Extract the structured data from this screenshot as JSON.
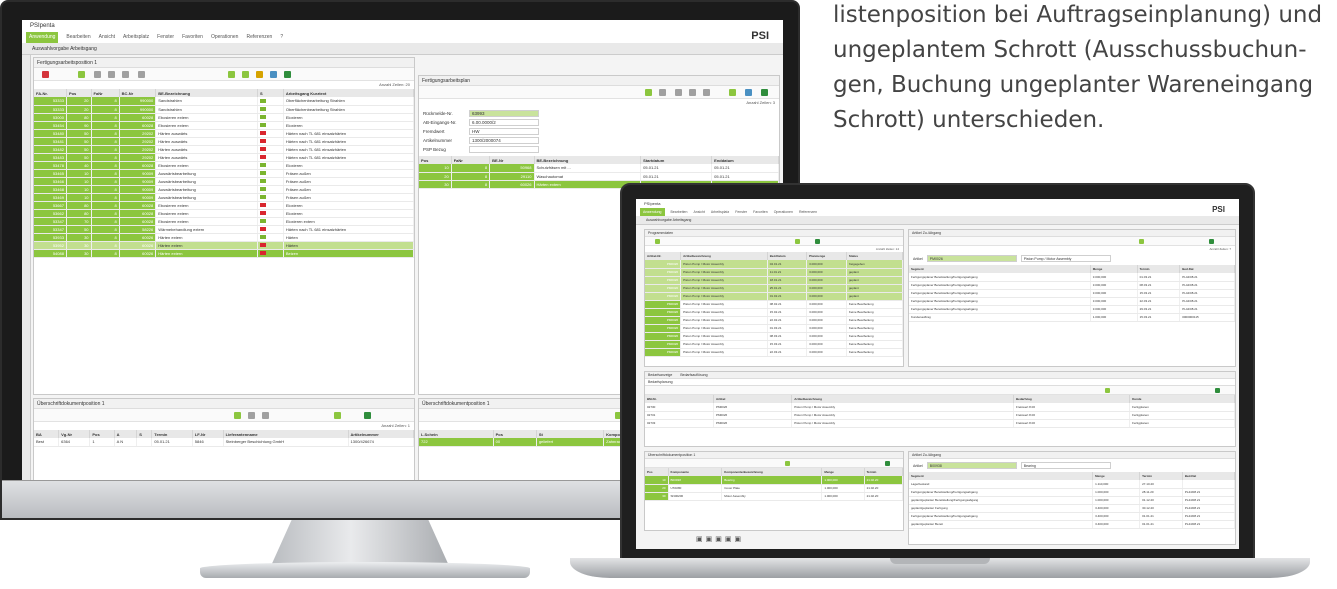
{
  "caption": {
    "lines": [
      "listenposition bei Auftragseinplanung) und",
      "ungeplantem Schrott (Ausschussbuchun-",
      "gen, Buchung ungeplanter Wareneingang",
      "Schrott) unterschieden."
    ]
  },
  "app": {
    "title": "PSIpenta",
    "logo": "PSI",
    "menu": [
      "Anwendung",
      "Bearbeiten",
      "Ansicht",
      "Arbeitsplatz",
      "Fenster",
      "Favoriten",
      "Operationen",
      "Referenzen",
      "?"
    ],
    "tab": "Auswahlvorgabe Arbeitsgang"
  },
  "monitor": {
    "left_panel": {
      "title": "Fertigungsarbeitsposition 1",
      "count": "Anzahl Zeilen: 20",
      "columns": [
        "FA-Nr.",
        "Pos",
        "FaNr",
        "BC-Nr",
        "BE-Bezeichnung",
        "S",
        "Arbeitsgang Kurztext"
      ],
      "rows": [
        [
          "53333",
          "20",
          "8",
          "990000",
          "Sandstrahlen",
          "grn",
          "Oberflächenbearbeitung Strahlen"
        ],
        [
          "53333",
          "20",
          "8",
          "990000",
          "Sandstrahlen",
          "grn",
          "Oberflächenbearbeitung Strahlen"
        ],
        [
          "53000",
          "80",
          "8",
          "60028",
          "Ebosieren extern",
          "grn",
          "Eloxieren"
        ],
        [
          "53454",
          "90",
          "8",
          "60028",
          "Ebosieren extern",
          "grn",
          "Eloxieren"
        ],
        [
          "53480",
          "50",
          "8",
          "29202",
          "Härten auswärts",
          "red",
          "Härten nach TL 681 einsatzhärten"
        ],
        [
          "53481",
          "50",
          "8",
          "29202",
          "Härten auswärts",
          "red",
          "Härten nach TL 681 einsatzhärten"
        ],
        [
          "53482",
          "50",
          "8",
          "29202",
          "Härten auswärts",
          "red",
          "Härten nach TL 681 einsatzhärten"
        ],
        [
          "53483",
          "50",
          "8",
          "29202",
          "Härten auswärts",
          "red",
          "Härten nach TL 681 einsatzhärten"
        ],
        [
          "53478",
          "40",
          "8",
          "60028",
          "Ebosieren extern",
          "grn",
          "Eloxieren"
        ],
        [
          "53465",
          "10",
          "8",
          "90009",
          "Auswärtsbearbeitung",
          "grn",
          "Fräsen außen"
        ],
        [
          "53466",
          "10",
          "8",
          "90009",
          "Auswärtsbearbeitung",
          "grn",
          "Fräsen außen"
        ],
        [
          "53468",
          "10",
          "8",
          "90009",
          "Auswärtsbearbeitung",
          "grn",
          "Fräsen außen"
        ],
        [
          "53469",
          "10",
          "8",
          "90009",
          "Auswärtsbearbeitung",
          "grn",
          "Fräsen außen"
        ],
        [
          "53667",
          "80",
          "8",
          "60028",
          "Ebosieren extern",
          "red",
          "Eloxieren"
        ],
        [
          "53662",
          "80",
          "8",
          "60028",
          "Ebosieren extern",
          "red",
          "Eloxieren"
        ],
        [
          "53347",
          "70",
          "8",
          "60028",
          "Ebosieren extern",
          "grn",
          "Eloxieren extern"
        ],
        [
          "53347",
          "50",
          "8",
          "58226",
          "Wärmebehandlung extern",
          "red",
          "Härten nach TL 681 einsatzhärten"
        ],
        [
          "53933",
          "30",
          "8",
          "60026",
          "Härten extern",
          "grn",
          "Härten"
        ],
        [
          "53952",
          "30",
          "8",
          "60026",
          "Härten extern",
          "red",
          "Härten"
        ],
        [
          "54088",
          "30",
          "8",
          "60026",
          "Härten extern",
          "red",
          "Beizen"
        ]
      ]
    },
    "right_panel": {
      "title": "Fertigungsarbeitsplan",
      "count": "Anzahl Zeilen: 3",
      "form": [
        [
          "Rückmelde-Nr.",
          "63993"
        ],
        [
          "AB-Eingangs-Nr.",
          "6.00.0000/2"
        ],
        [
          "Fremdwert",
          "HW"
        ],
        [
          "Artikelnummer",
          "1300/2000074"
        ],
        [
          "PSP Bezug",
          ""
        ]
      ],
      "columns": [
        "Pos",
        "FaNr",
        "BE-Nr",
        "BE-Bezeichnung",
        "Startdatum",
        "Enddatum"
      ],
      "rows": [
        [
          "10",
          "8",
          "50968",
          "Schutzfräsen mit ...",
          "05.01.21",
          "05.01.21"
        ],
        [
          "20",
          "8",
          "29110",
          "Waschautomat",
          "05.01.21",
          "05.01.21"
        ],
        [
          "30",
          "8",
          "60026",
          "Härten extern",
          "05.01.21",
          "05.01.21"
        ]
      ]
    },
    "bottom_left": {
      "title": "Überschriftdokumentposition 1",
      "count": "Anzahl Zeilen: 1",
      "columns": [
        "BA",
        "Vg-Nr",
        "Pos",
        "A",
        "S",
        "Termin",
        "LF-Nr",
        "Lieferantenname",
        "Artikelnummer"
      ],
      "row": [
        "Best",
        "6364",
        "1",
        "A N",
        "",
        "05.01.21",
        "5846",
        "Steinberger Beschichtung GmbH",
        "1300/426674"
      ]
    },
    "bottom_right": {
      "title": "Überschriftdokumentposition 1",
      "count": "Anzahl Zeilen: 1",
      "columns": [
        "L.Schein",
        "Pos",
        "St",
        "Komponente"
      ],
      "row": [
        "722",
        "00",
        "geliefert",
        "Zahnrad 65/0,9/22/4/17/2"
      ]
    }
  },
  "laptop": {
    "left_panel": {
      "title": "Programmdaten",
      "count": "Anzahl Zeilen: 14",
      "columns": [
        "Artikel-Nr.",
        "Artikelbezeichnung",
        "Bed.Datum",
        "Planmenge",
        "Status"
      ],
      "rows": [
        [
          "PM0026",
          "Piston Pump / Motor Assembly",
          "04.01.21",
          "3.000,000",
          "freigegeben"
        ],
        [
          "PM0026",
          "Piston Pump / Motor Assembly",
          "11.01.21",
          "3.000,000",
          "geplant"
        ],
        [
          "PM0026",
          "Piston Pump / Motor Assembly",
          "18.01.21",
          "3.000,000",
          "geplant"
        ],
        [
          "PM0026",
          "Piston Pump / Motor Assembly",
          "25.01.21",
          "3.000,000",
          "geplant"
        ],
        [
          "PM0026",
          "Piston Pump / Motor Assembly",
          "01.02.21",
          "3.000,000",
          "geplant"
        ],
        [
          "PM0026",
          "Piston Pump / Motor Assembly",
          "08.02.21",
          "3.000,000",
          "Keine Bearbeitung"
        ],
        [
          "PM0026",
          "Piston Pump / Motor Assembly",
          "15.02.21",
          "3.000,000",
          "Keine Bearbeitung"
        ],
        [
          "PM0026",
          "Piston Pump / Motor Assembly",
          "22.02.21",
          "3.000,000",
          "Keine Bearbeitung"
        ],
        [
          "PM0026",
          "Piston Pump / Motor Assembly",
          "01.03.21",
          "3.000,000",
          "Keine Bearbeitung"
        ],
        [
          "PM0026",
          "Piston Pump / Motor Assembly",
          "08.03.21",
          "3.000,000",
          "Keine Bearbeitung"
        ],
        [
          "PM0026",
          "Piston Pump / Motor Assembly",
          "15.03.21",
          "3.000,000",
          "Keine Bearbeitung"
        ],
        [
          "PM0026",
          "Piston Pump / Motor Assembly",
          "22.03.21",
          "3.000,000",
          "Keine Bearbeitung"
        ]
      ]
    },
    "right_panel": {
      "title": "Artikel Zu-/Abgang",
      "count": "Anzahl Zeilen: 7",
      "field_label": "Artikel",
      "field_value": "PM0026",
      "desc": "Piston Pump / Motor Assembly",
      "columns": [
        "Segment",
        "Menge",
        "Termin",
        "Bed.Dat"
      ],
      "rows": [
        [
          "Fertigungsplaner Bereitstellung/Fertigungsabgang",
          "3.000,000",
          "01.03.21",
          "PL44/08.21"
        ],
        [
          "Fertigungsplaner Bereitstellung/Fertigungsabgang",
          "3.000,000",
          "08.03.21",
          "PL44/08.21"
        ],
        [
          "Fertigungsplaner Bereitstellung/Fertigungsabgang",
          "3.000,000",
          "15.03.21",
          "PL44/08.21"
        ],
        [
          "Fertigungsplaner Bereitstellung/Fertigungsabgang",
          "3.000,000",
          "22.03.21",
          "PL44/08.21"
        ],
        [
          "Fertigungsplaner Bereitstellung/Fertigungsabgang",
          "3.000,000",
          "29.03.21",
          "PL44/08.21"
        ],
        [
          "Kundenauftrag",
          "1.000,000",
          "15.03.21",
          "0000000115"
        ]
      ]
    },
    "mid_panel": {
      "tabs": [
        "Bedarfsanzeige",
        "Bedarfsauflösung"
      ],
      "sub": "Bedarfsplanung",
      "columns": [
        "BM-Nr.",
        "Artikel",
        "Artikelbezeichnung",
        "Bedarfstag",
        "Kunde"
      ],
      "rows": [
        [
          "02730",
          "PM0026",
          "Piston Pump / Motor Assembly",
          "Freiswert 8.00",
          "Fertigplanen"
        ],
        [
          "02731",
          "PM0026",
          "Piston Pump / Motor Assembly",
          "Freiswert 8.00",
          "Fertigplanen"
        ],
        [
          "02733",
          "PM0026",
          "Piston Pump / Motor Assembly",
          "Freiswert 8.00",
          "Fertigplanen"
        ]
      ]
    },
    "bottom_left": {
      "title": "Überschriftdokumentposition 1",
      "columns": [
        "Pos",
        "Komponente",
        "Komponentenbezeichnung",
        "Menge",
        "Termin"
      ],
      "rows": [
        [
          "10",
          "B00938",
          "Bearing",
          "1.000,000",
          "21.02.20"
        ],
        [
          "20",
          "UTA080",
          "Cover Plate",
          "1.000,000",
          "21.02.20"
        ],
        [
          "30",
          "SN00206",
          "Motor Assembly",
          "1.000,000",
          "21.02.20"
        ]
      ]
    },
    "bottom_right": {
      "title": "Artikel Zu-/Abgang",
      "field_value": "B00938",
      "desc": "Bearing",
      "columns": [
        "Segment",
        "Menge",
        "Termin",
        "Bed.Dat"
      ],
      "rows": [
        [
          "Lagerbestand",
          "1.110,000",
          "27.10.20",
          ""
        ],
        [
          "Fertigungsplaner Bereitstellung/Fertigungsabgang",
          "1.000,000",
          "28.11.20",
          "PL44/08.21"
        ],
        [
          "geplant/geplanter Bereitstellung/Fertigungsabgang",
          "1.000,000",
          "01.12.20",
          "PL44/08.21"
        ],
        [
          "geplant/geplanter Fertigung",
          "3.400,000",
          "30.12.20",
          "PL44/08.21"
        ],
        [
          "Fertigungsplaner Bereitstellung/Fertigungsabgang",
          "3.400,000",
          "01.01.21",
          "PL44/08.21"
        ],
        [
          "geplant/geplanter Bereit",
          "3.400,000",
          "01.01.21",
          "PL44/08.21"
        ]
      ]
    }
  }
}
